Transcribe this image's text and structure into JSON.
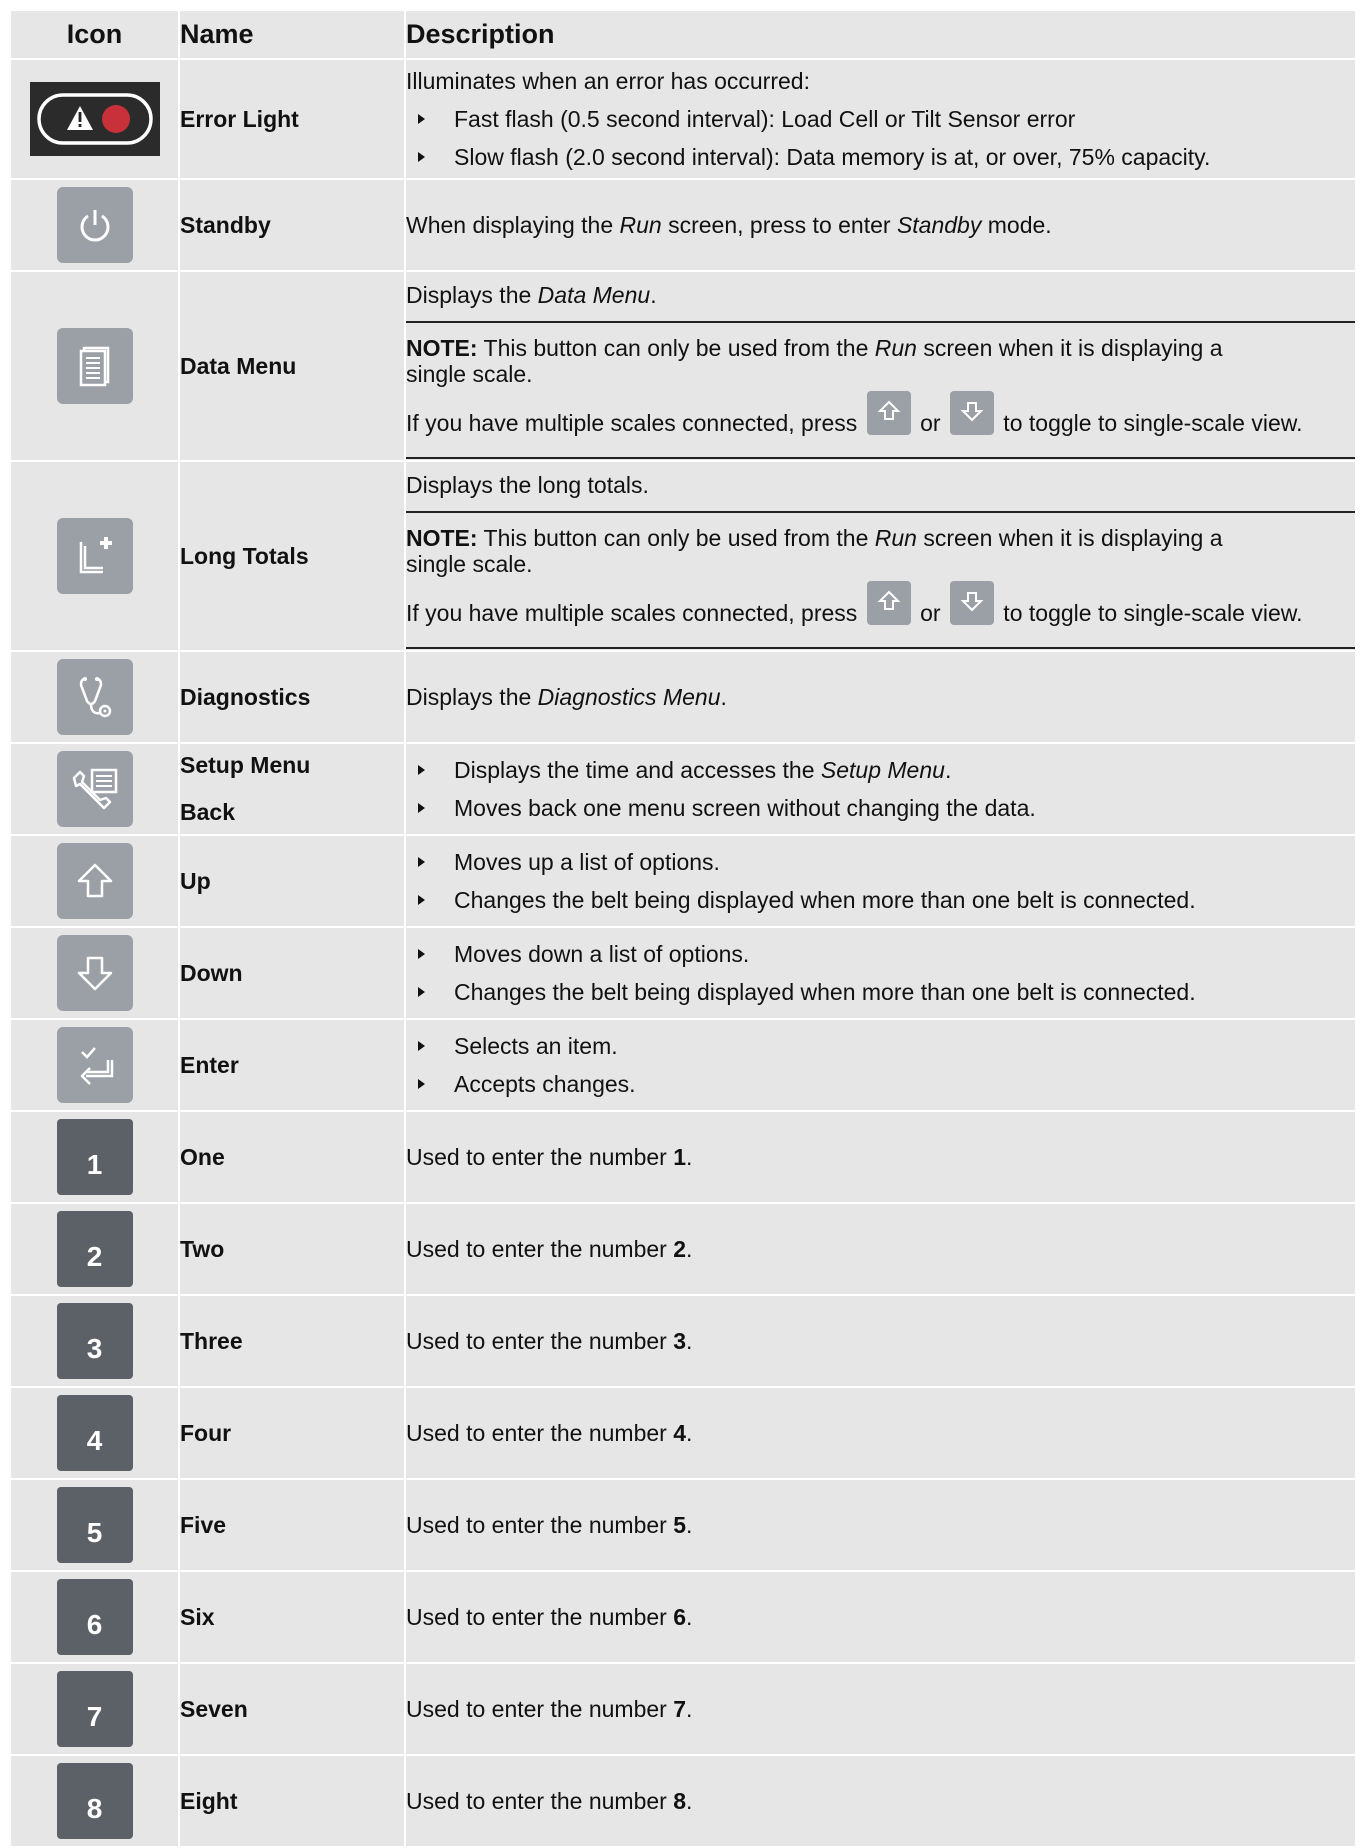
{
  "header": {
    "icon": "Icon",
    "name": "Name",
    "description": "Description"
  },
  "colors": {
    "cell_bg": "#e6e6e6",
    "icon_button": "#9aa0a6",
    "number_button": "#5b6166",
    "error_red": "#c8313a"
  },
  "rows": {
    "error_light": {
      "icon": "error-light-icon",
      "name": "Error Light",
      "intro": "Illuminates when an error has occurred:",
      "bullet1": "Fast flash (0.5 second interval): Load Cell or Tilt Sensor error",
      "bullet2": "Slow flash (2.0 second interval): Data memory is at, or over, 75% capacity."
    },
    "standby": {
      "icon": "power-icon",
      "name": "Standby",
      "t1": "When displaying the ",
      "em1": "Run",
      "t2": " screen, press to enter ",
      "em2": "Standby",
      "t3": " mode."
    },
    "data_menu": {
      "icon": "document-list-icon",
      "name": "Data Menu",
      "l1_t1": "Displays the ",
      "l1_em": "Data Menu",
      "l1_t2": ".",
      "note_label": "NOTE:",
      "note_t1": " This button can only be used from the ",
      "note_em": "Run",
      "note_t2": " screen when it is displaying a single scale.",
      "multi_t1": "If you have multiple scales connected, press ",
      "multi_or": " or ",
      "multi_t2": " to toggle to single-scale view."
    },
    "long_totals": {
      "icon": "long-totals-plus-icon",
      "name": "Long Totals",
      "l1": "Displays the long totals.",
      "note_label": "NOTE:",
      "note_t1": " This button can only be used from the ",
      "note_em": "Run",
      "note_t2": " screen when it is displaying a single scale.",
      "multi_t1": "If you have multiple scales connected, press ",
      "multi_or": " or ",
      "multi_t2": " to toggle to single-scale view."
    },
    "diagnostics": {
      "icon": "stethoscope-icon",
      "name": "Diagnostics",
      "t1": "Displays the ",
      "em": "Diagnostics Menu",
      "t2": "."
    },
    "setup": {
      "icon": "wrench-list-icon",
      "name1": "Setup Menu",
      "name2": "Back",
      "b1_t1": "Displays the time and accesses the ",
      "b1_em": "Setup Menu",
      "b1_t2": ".",
      "b2": "Moves back one menu screen without changing the data."
    },
    "up": {
      "icon": "arrow-up-icon",
      "name": "Up",
      "b1": "Moves up a list of options.",
      "b2": "Changes the belt being displayed when more than one belt is connected."
    },
    "down": {
      "icon": "arrow-down-icon",
      "name": "Down",
      "b1": "Moves down a list of options.",
      "b2": "Changes the belt being displayed when more than one belt is connected."
    },
    "enter": {
      "icon": "enter-check-icon",
      "name": "Enter",
      "b1": "Selects an item.",
      "b2": "Accepts changes."
    },
    "numbers_prefix": "Used to enter the number ",
    "numbers_suffix": ".",
    "numbers": [
      {
        "key": "1",
        "name": "One"
      },
      {
        "key": "2",
        "name": "Two"
      },
      {
        "key": "3",
        "name": "Three"
      },
      {
        "key": "4",
        "name": "Four"
      },
      {
        "key": "5",
        "name": "Five"
      },
      {
        "key": "6",
        "name": "Six"
      },
      {
        "key": "7",
        "name": "Seven"
      },
      {
        "key": "8",
        "name": "Eight"
      }
    ]
  }
}
